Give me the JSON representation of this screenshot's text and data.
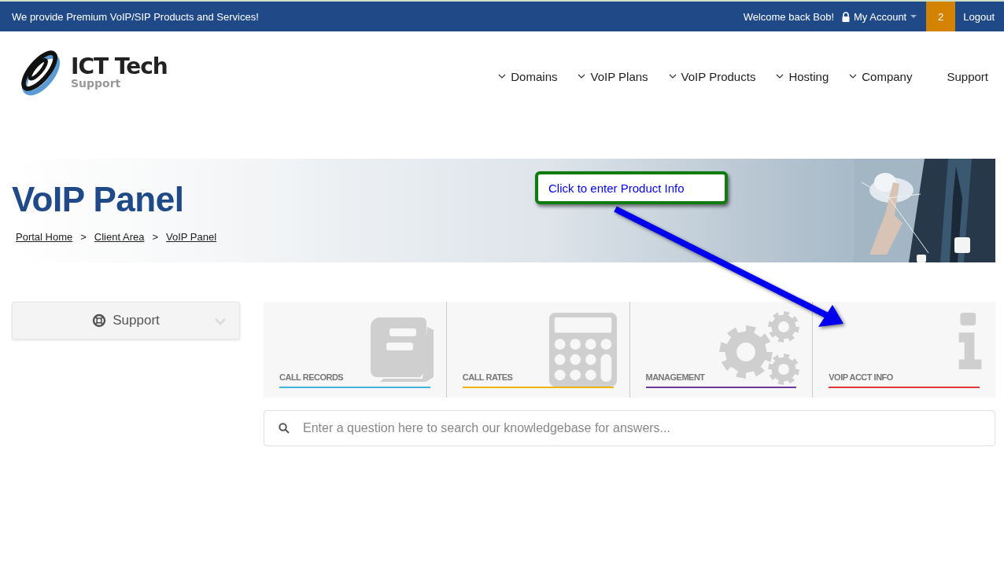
{
  "top_bar": {
    "tagline": "We provide Premium VoIP/SIP Products and Services!",
    "welcome": "Welcome back Bob!",
    "account": "My Account",
    "badge": "2",
    "logout": "Logout"
  },
  "logo": {
    "name": "ICT Tech",
    "sub": "Support"
  },
  "nav": [
    {
      "label": "Domains",
      "dropdown": true
    },
    {
      "label": "VoIP Plans",
      "dropdown": true
    },
    {
      "label": "VoIP Products",
      "dropdown": true
    },
    {
      "label": "Hosting",
      "dropdown": true
    },
    {
      "label": "Company",
      "dropdown": true
    },
    {
      "label": "Support",
      "dropdown": false
    }
  ],
  "banner": {
    "title": "VoIP Panel",
    "breadcrumb": [
      "Portal Home",
      "Client Area",
      "VoIP Panel"
    ],
    "separator": ">",
    "kind": "picture"
  },
  "callout": {
    "text": "Click to enter Product Info"
  },
  "sidebar": {
    "label": "Support",
    "expanded": false
  },
  "tiles": [
    {
      "label": "CALL RECORDS",
      "kind": "book",
      "color": "#3fb3d9"
    },
    {
      "label": "CALL RATES",
      "kind": "calculator",
      "color": "#f0b400"
    },
    {
      "label": "MANAGEMENT",
      "kind": "gears",
      "color": "#6a3a9a"
    },
    {
      "label": "VOIP ACCT INFO",
      "kind": "info",
      "color": "#e0353a"
    }
  ],
  "search": {
    "placeholder": "Enter a question here to search our knowledgebase for answers..."
  }
}
